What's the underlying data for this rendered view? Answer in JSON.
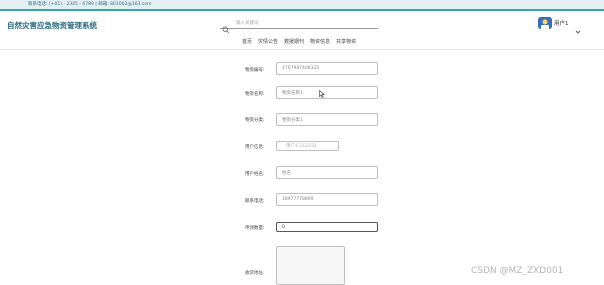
{
  "topbar": {
    "contact": "联系电话: (+01) - 2345 - 6789 | 邮箱: 801002@163.com"
  },
  "header": {
    "title": "自然灾害应急物资管理系统",
    "search_placeholder": "输入关键词",
    "username": "用户1"
  },
  "nav": {
    "items": [
      "首页",
      "灾情公告",
      "救援期刊",
      "物资信息",
      "共享物资"
    ]
  },
  "form": {
    "fields": [
      {
        "label": "物资编号:",
        "value": "1707987406335"
      },
      {
        "label": "物资名称:",
        "value": "物资名称1"
      },
      {
        "label": "物资分类:",
        "value": "物资分类1"
      },
      {
        "label": "用户信息:",
        "value": "用户1-112233"
      },
      {
        "label": "用户姓名:",
        "value": "姓名"
      },
      {
        "label": "联系电话:",
        "value": "18977778899"
      },
      {
        "label": "申领数量:",
        "value": "0"
      },
      {
        "label": "收货地址:",
        "value": ""
      }
    ]
  },
  "watermark": "CSDN @MZ_ZXD001",
  "colors": {
    "accent": "#36a9a6",
    "title": "#2b6c80",
    "topbar_bg": "#e4eff4"
  }
}
